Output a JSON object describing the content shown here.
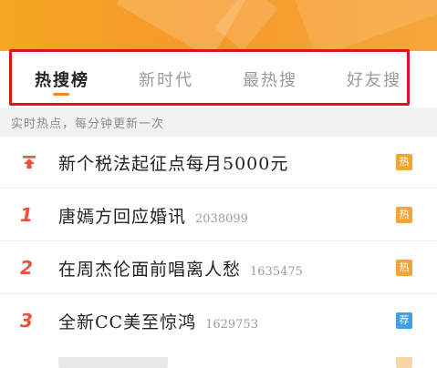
{
  "tabs": [
    {
      "label": "热搜榜",
      "active": true
    },
    {
      "label": "新时代",
      "active": false
    },
    {
      "label": "最热搜",
      "active": false
    },
    {
      "label": "好友搜",
      "active": false
    }
  ],
  "subheader": "实时热点，每分钟更新一次",
  "list": [
    {
      "rank": "",
      "rank_icon": "pin-top-icon",
      "title": "新个税法起征点每月5000元",
      "count": "",
      "badge": "热",
      "badge_type": "hot"
    },
    {
      "rank": "1",
      "title": "唐嫣方回应婚讯",
      "count": "2038099",
      "badge": "热",
      "badge_type": "hot"
    },
    {
      "rank": "2",
      "title": "在周杰伦面前唱离人愁",
      "count": "1635475",
      "badge": "热",
      "badge_type": "hot"
    },
    {
      "rank": "3",
      "title": "全新CC美至惊鸿",
      "count": "1629753",
      "badge": "荐",
      "badge_type": "rec"
    }
  ],
  "colors": {
    "banner": "#f7992a",
    "highlight": "#e0121a",
    "rank": "#e9523b",
    "badge_hot": "#f4a531",
    "badge_rec": "#3aa0e8"
  }
}
